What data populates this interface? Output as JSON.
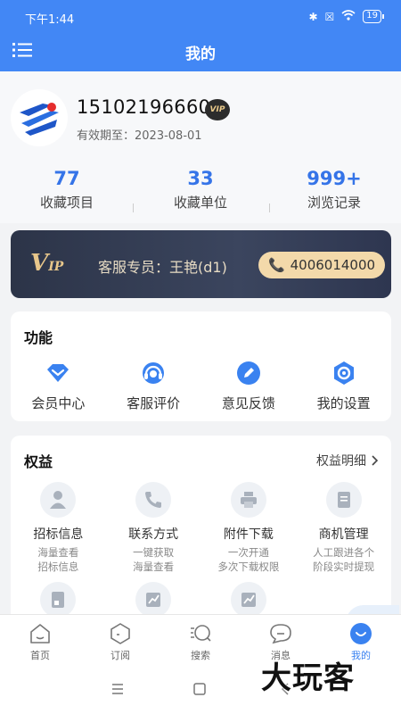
{
  "status": {
    "time": "下午1:44",
    "battery": "19"
  },
  "header": {
    "title": "我的",
    "menu_icon": "menu-icon"
  },
  "profile": {
    "phone": "15102196660",
    "vip_badge": "VIP",
    "valid_until": "有效期至：2023-08-01"
  },
  "stats": [
    {
      "value": "77",
      "label": "收藏项目"
    },
    {
      "value": "33",
      "label": "收藏单位"
    },
    {
      "value": "999+",
      "label": "浏览记录"
    }
  ],
  "vip_banner": {
    "logo_v": "V",
    "logo_ip": "IP",
    "service_rep": "客服专员：王艳(d1)",
    "service_phone": "4006014000"
  },
  "functions": {
    "title": "功能",
    "items": [
      {
        "label": "会员中心",
        "icon": "diamond-icon"
      },
      {
        "label": "客服评价",
        "icon": "headset-icon"
      },
      {
        "label": "意见反馈",
        "icon": "pen-icon"
      },
      {
        "label": "我的设置",
        "icon": "settings-icon"
      }
    ]
  },
  "rights": {
    "title": "权益",
    "detail_link": "权益明细",
    "items": [
      {
        "name": "招标信息",
        "desc1": "海量查看",
        "desc2": "招标信息",
        "icon": "person-icon"
      },
      {
        "name": "联系方式",
        "desc1": "一键获取",
        "desc2": "海量查看",
        "icon": "phone-icon"
      },
      {
        "name": "附件下载",
        "desc1": "一次开通",
        "desc2": "多次下载权限",
        "icon": "printer-icon"
      },
      {
        "name": "商机管理",
        "desc1": "人工跟进各个",
        "desc2": "阶段实时提现",
        "icon": "document-icon"
      },
      {
        "name": "",
        "desc1": "",
        "desc2": "",
        "icon": "report-icon"
      },
      {
        "name": "",
        "desc1": "",
        "desc2": "",
        "icon": "chart-icon"
      },
      {
        "name": "",
        "desc1": "",
        "desc2": "",
        "icon": "chart-icon"
      }
    ]
  },
  "tabs": [
    {
      "label": "首页",
      "icon": "home-icon"
    },
    {
      "label": "订阅",
      "icon": "subscribe-icon"
    },
    {
      "label": "搜索",
      "icon": "search-icon"
    },
    {
      "label": "消息",
      "icon": "message-icon"
    },
    {
      "label": "我的",
      "icon": "profile-icon"
    }
  ],
  "watermark": "大玩客",
  "colors": {
    "primary": "#4287f5",
    "accent": "#3574e8",
    "vip_gold": "#f3d9aa",
    "vip_dark": "#2c3448"
  }
}
